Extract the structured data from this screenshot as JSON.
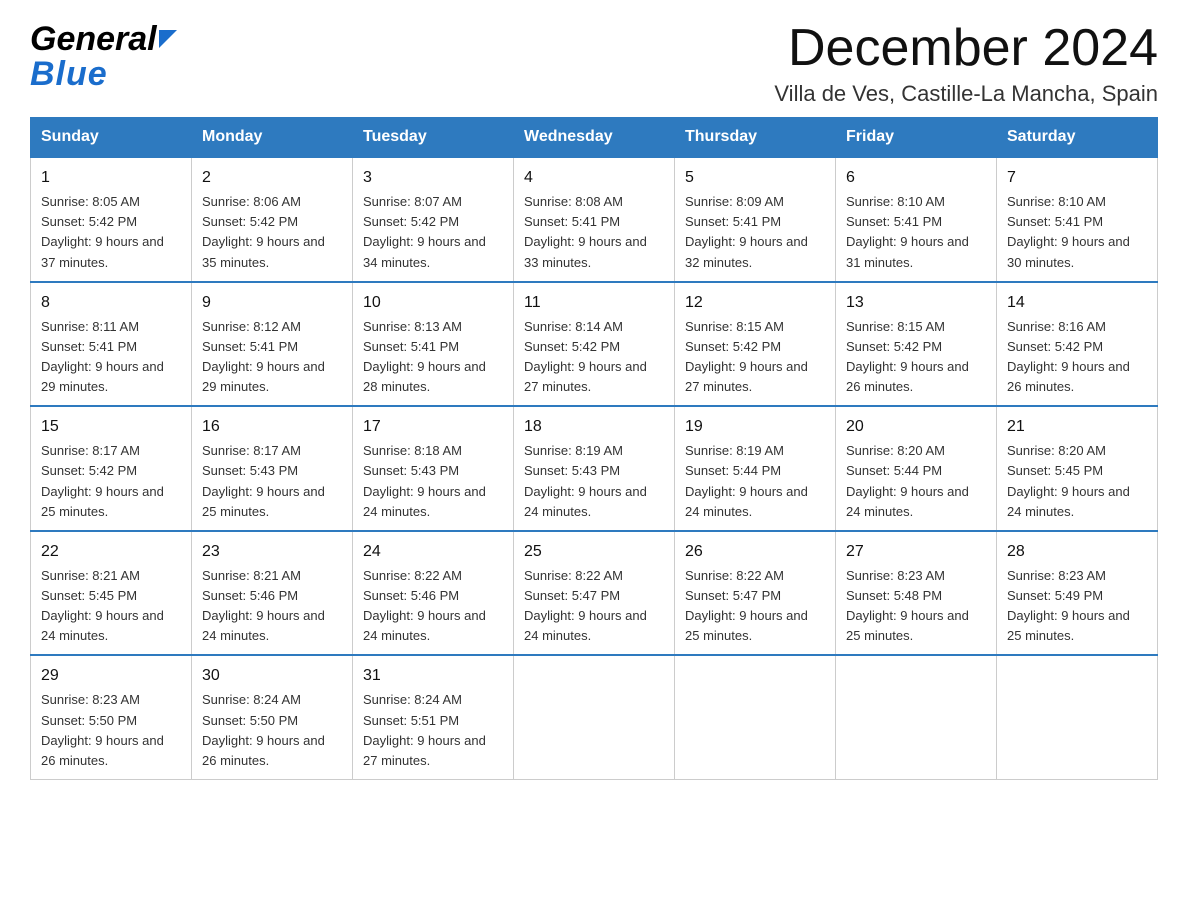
{
  "header": {
    "logo_general": "General",
    "logo_blue": "Blue",
    "main_title": "December 2024",
    "subtitle": "Villa de Ves, Castille-La Mancha, Spain"
  },
  "calendar": {
    "days_of_week": [
      "Sunday",
      "Monday",
      "Tuesday",
      "Wednesday",
      "Thursday",
      "Friday",
      "Saturday"
    ],
    "weeks": [
      [
        {
          "day": "1",
          "sunrise": "8:05 AM",
          "sunset": "5:42 PM",
          "daylight": "9 hours and 37 minutes."
        },
        {
          "day": "2",
          "sunrise": "8:06 AM",
          "sunset": "5:42 PM",
          "daylight": "9 hours and 35 minutes."
        },
        {
          "day": "3",
          "sunrise": "8:07 AM",
          "sunset": "5:42 PM",
          "daylight": "9 hours and 34 minutes."
        },
        {
          "day": "4",
          "sunrise": "8:08 AM",
          "sunset": "5:41 PM",
          "daylight": "9 hours and 33 minutes."
        },
        {
          "day": "5",
          "sunrise": "8:09 AM",
          "sunset": "5:41 PM",
          "daylight": "9 hours and 32 minutes."
        },
        {
          "day": "6",
          "sunrise": "8:10 AM",
          "sunset": "5:41 PM",
          "daylight": "9 hours and 31 minutes."
        },
        {
          "day": "7",
          "sunrise": "8:10 AM",
          "sunset": "5:41 PM",
          "daylight": "9 hours and 30 minutes."
        }
      ],
      [
        {
          "day": "8",
          "sunrise": "8:11 AM",
          "sunset": "5:41 PM",
          "daylight": "9 hours and 29 minutes."
        },
        {
          "day": "9",
          "sunrise": "8:12 AM",
          "sunset": "5:41 PM",
          "daylight": "9 hours and 29 minutes."
        },
        {
          "day": "10",
          "sunrise": "8:13 AM",
          "sunset": "5:41 PM",
          "daylight": "9 hours and 28 minutes."
        },
        {
          "day": "11",
          "sunrise": "8:14 AM",
          "sunset": "5:42 PM",
          "daylight": "9 hours and 27 minutes."
        },
        {
          "day": "12",
          "sunrise": "8:15 AM",
          "sunset": "5:42 PM",
          "daylight": "9 hours and 27 minutes."
        },
        {
          "day": "13",
          "sunrise": "8:15 AM",
          "sunset": "5:42 PM",
          "daylight": "9 hours and 26 minutes."
        },
        {
          "day": "14",
          "sunrise": "8:16 AM",
          "sunset": "5:42 PM",
          "daylight": "9 hours and 26 minutes."
        }
      ],
      [
        {
          "day": "15",
          "sunrise": "8:17 AM",
          "sunset": "5:42 PM",
          "daylight": "9 hours and 25 minutes."
        },
        {
          "day": "16",
          "sunrise": "8:17 AM",
          "sunset": "5:43 PM",
          "daylight": "9 hours and 25 minutes."
        },
        {
          "day": "17",
          "sunrise": "8:18 AM",
          "sunset": "5:43 PM",
          "daylight": "9 hours and 24 minutes."
        },
        {
          "day": "18",
          "sunrise": "8:19 AM",
          "sunset": "5:43 PM",
          "daylight": "9 hours and 24 minutes."
        },
        {
          "day": "19",
          "sunrise": "8:19 AM",
          "sunset": "5:44 PM",
          "daylight": "9 hours and 24 minutes."
        },
        {
          "day": "20",
          "sunrise": "8:20 AM",
          "sunset": "5:44 PM",
          "daylight": "9 hours and 24 minutes."
        },
        {
          "day": "21",
          "sunrise": "8:20 AM",
          "sunset": "5:45 PM",
          "daylight": "9 hours and 24 minutes."
        }
      ],
      [
        {
          "day": "22",
          "sunrise": "8:21 AM",
          "sunset": "5:45 PM",
          "daylight": "9 hours and 24 minutes."
        },
        {
          "day": "23",
          "sunrise": "8:21 AM",
          "sunset": "5:46 PM",
          "daylight": "9 hours and 24 minutes."
        },
        {
          "day": "24",
          "sunrise": "8:22 AM",
          "sunset": "5:46 PM",
          "daylight": "9 hours and 24 minutes."
        },
        {
          "day": "25",
          "sunrise": "8:22 AM",
          "sunset": "5:47 PM",
          "daylight": "9 hours and 24 minutes."
        },
        {
          "day": "26",
          "sunrise": "8:22 AM",
          "sunset": "5:47 PM",
          "daylight": "9 hours and 25 minutes."
        },
        {
          "day": "27",
          "sunrise": "8:23 AM",
          "sunset": "5:48 PM",
          "daylight": "9 hours and 25 minutes."
        },
        {
          "day": "28",
          "sunrise": "8:23 AM",
          "sunset": "5:49 PM",
          "daylight": "9 hours and 25 minutes."
        }
      ],
      [
        {
          "day": "29",
          "sunrise": "8:23 AM",
          "sunset": "5:50 PM",
          "daylight": "9 hours and 26 minutes."
        },
        {
          "day": "30",
          "sunrise": "8:24 AM",
          "sunset": "5:50 PM",
          "daylight": "9 hours and 26 minutes."
        },
        {
          "day": "31",
          "sunrise": "8:24 AM",
          "sunset": "5:51 PM",
          "daylight": "9 hours and 27 minutes."
        },
        null,
        null,
        null,
        null
      ]
    ]
  }
}
